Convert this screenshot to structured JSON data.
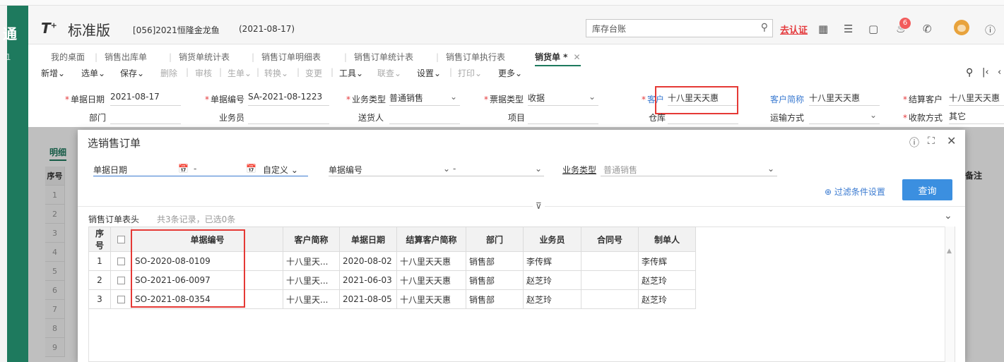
{
  "sidebar": {
    "glyph": "通",
    "glyph2": "1"
  },
  "header": {
    "logo": "T",
    "logo_sup": "+",
    "edition": "标准版",
    "company": "[056]2021恒隆金龙鱼",
    "date": "(2021-08-17)",
    "search_value": "库存台账",
    "certify": "去认证",
    "badge_count": "6"
  },
  "tabs": [
    {
      "label": "我的桌面"
    },
    {
      "label": "销售出库单"
    },
    {
      "label": "销货单统计表"
    },
    {
      "label": "销售订单明细表"
    },
    {
      "label": "销售订单统计表"
    },
    {
      "label": "销售订单执行表"
    },
    {
      "label": "销货单 *"
    }
  ],
  "toolbar": {
    "new": "新增",
    "pick": "选单",
    "save": "保存",
    "delete": "删除",
    "audit": "审核",
    "generate": "生单",
    "convert": "转换",
    "change": "变更",
    "tools": "工具",
    "lookup": "联查",
    "settings": "设置",
    "print": "打印",
    "more": "更多"
  },
  "form": {
    "doc_date_label": "单据日期",
    "doc_date": "2021-08-17",
    "doc_no_label": "单据编号",
    "doc_no": "SA-2021-08-1223",
    "biz_type_label": "业务类型",
    "biz_type": "普通销售",
    "invoice_type_label": "票据类型",
    "invoice_type": "收据",
    "customer_label": "客户",
    "customer": "十八里天天惠",
    "customer_short_label": "客户简称",
    "customer_short": "十八里天天惠",
    "settle_customer_label": "结算客户",
    "settle_customer": "十八里天天惠",
    "dept_label": "部门",
    "salesman_label": "业务员",
    "deliverer_label": "送货人",
    "project_label": "项目",
    "warehouse_label": "仓库",
    "transport_label": "运输方式",
    "payment_label": "收款方式",
    "payment": "其它",
    "detail_tab": "明细",
    "row_header": "序号",
    "remark_header": "备注",
    "row_numbers": [
      "1",
      "2",
      "3",
      "4",
      "5",
      "6",
      "7",
      "8",
      "9"
    ]
  },
  "modal": {
    "title": "选销售订单",
    "date_label": "单据日期",
    "date_sep": "-",
    "date_mode": "自定义",
    "no_label": "单据编号",
    "no_sep": "-",
    "biz_type_label": "业务类型",
    "biz_type_value": "普通销售",
    "filter_link": "过滤条件设置",
    "query_button": "查询",
    "list_title": "销售订单表头",
    "list_count": "共3条记录，已选0条",
    "columns": [
      "序号",
      "",
      "单据编号",
      "客户简称",
      "单据日期",
      "结算客户简称",
      "部门",
      "业务员",
      "合同号",
      "制单人"
    ],
    "rows": [
      {
        "idx": "1",
        "no": "SO-2020-08-0109",
        "cust": "十八里天...",
        "date": "2020-08-02",
        "settle": "十八里天天惠",
        "dept": "销售部",
        "sales": "李传辉",
        "contract": "",
        "maker": "李传辉"
      },
      {
        "idx": "2",
        "no": "SO-2021-06-0097",
        "cust": "十八里天...",
        "date": "2021-06-03",
        "settle": "十八里天天惠",
        "dept": "销售部",
        "sales": "赵芝玲",
        "contract": "",
        "maker": "赵芝玲"
      },
      {
        "idx": "3",
        "no": "SO-2021-08-0354",
        "cust": "十八里天...",
        "date": "2021-08-05",
        "settle": "十八里天天惠",
        "dept": "销售部",
        "sales": "赵芝玲",
        "contract": "",
        "maker": "赵芝玲"
      }
    ]
  },
  "colors": {
    "accent_green": "#1e7a5e",
    "primary_blue": "#3b8fe0",
    "highlight_red": "#e53935"
  }
}
